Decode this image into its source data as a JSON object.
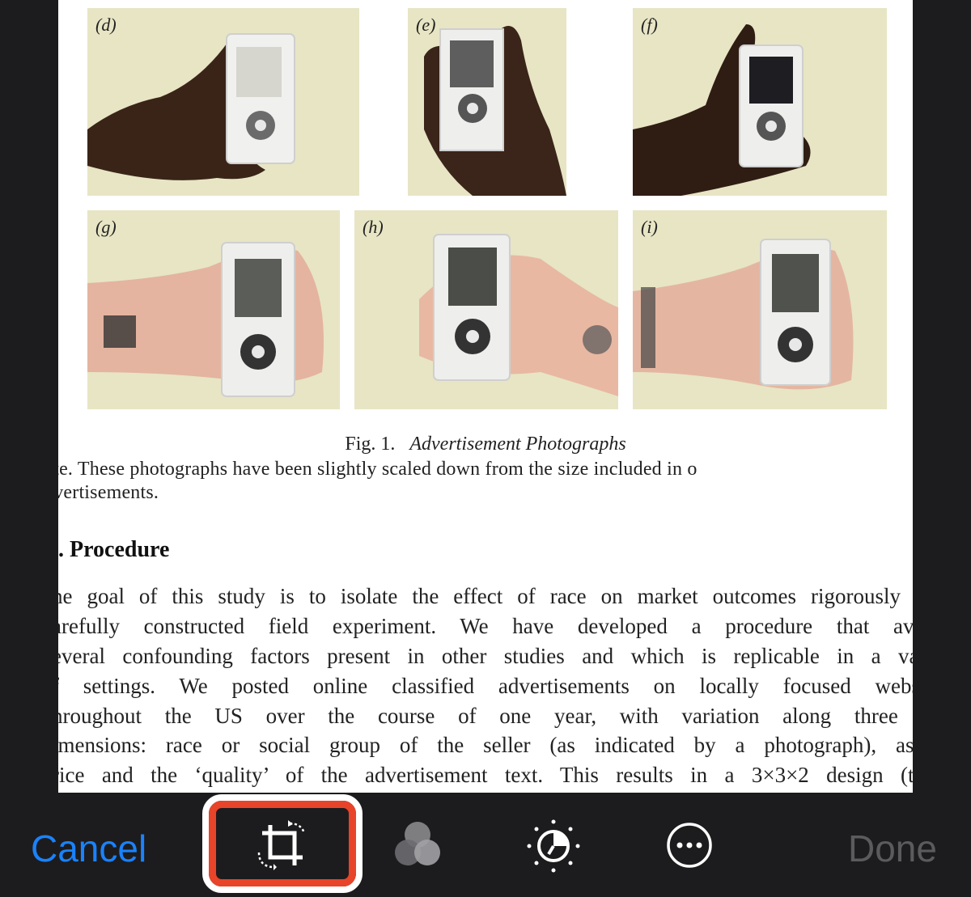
{
  "figure": {
    "photos": [
      {
        "label": "(d)"
      },
      {
        "label": "(e)"
      },
      {
        "label": "(f)"
      },
      {
        "label": "(g)"
      },
      {
        "label": "(h)"
      },
      {
        "label": "(i)"
      }
    ],
    "caption_prefix": "Fig. 1.",
    "caption_title": "Advertisement Photographs",
    "note_line1": "ote. These photographs have been slightly scaled down from the size included in o",
    "note_line2": "dvertisements."
  },
  "section": {
    "heading": ". Procedure",
    "lines": [
      "he goal of this study is to isolate the effect of race on market outcomes rigorously via",
      "arefully constructed field experiment. We have developed a procedure that avoid",
      "everal confounding factors present in other studies and which is replicable in a varie",
      "f settings. We posted online classified advertisements on locally focused website",
      "hroughout the US over the course of one year, with variation along three ke",
      "imensions: race or social group of the seller (as indicated by a photograph), askin",
      "rice and the ‘quality’ of the advertisement text. This results in a 3×3×2 design (thre"
    ]
  },
  "toolbar": {
    "cancel_label": "Cancel",
    "done_label": "Done",
    "tools": [
      {
        "icon": "crop-rotate-icon",
        "selected": true
      },
      {
        "icon": "filters-icon",
        "selected": false
      },
      {
        "icon": "adjust-dial-icon",
        "selected": false
      },
      {
        "icon": "more-icon",
        "selected": false
      }
    ],
    "accent_color": "#1a82fb",
    "highlight_color": "#e8442a"
  }
}
